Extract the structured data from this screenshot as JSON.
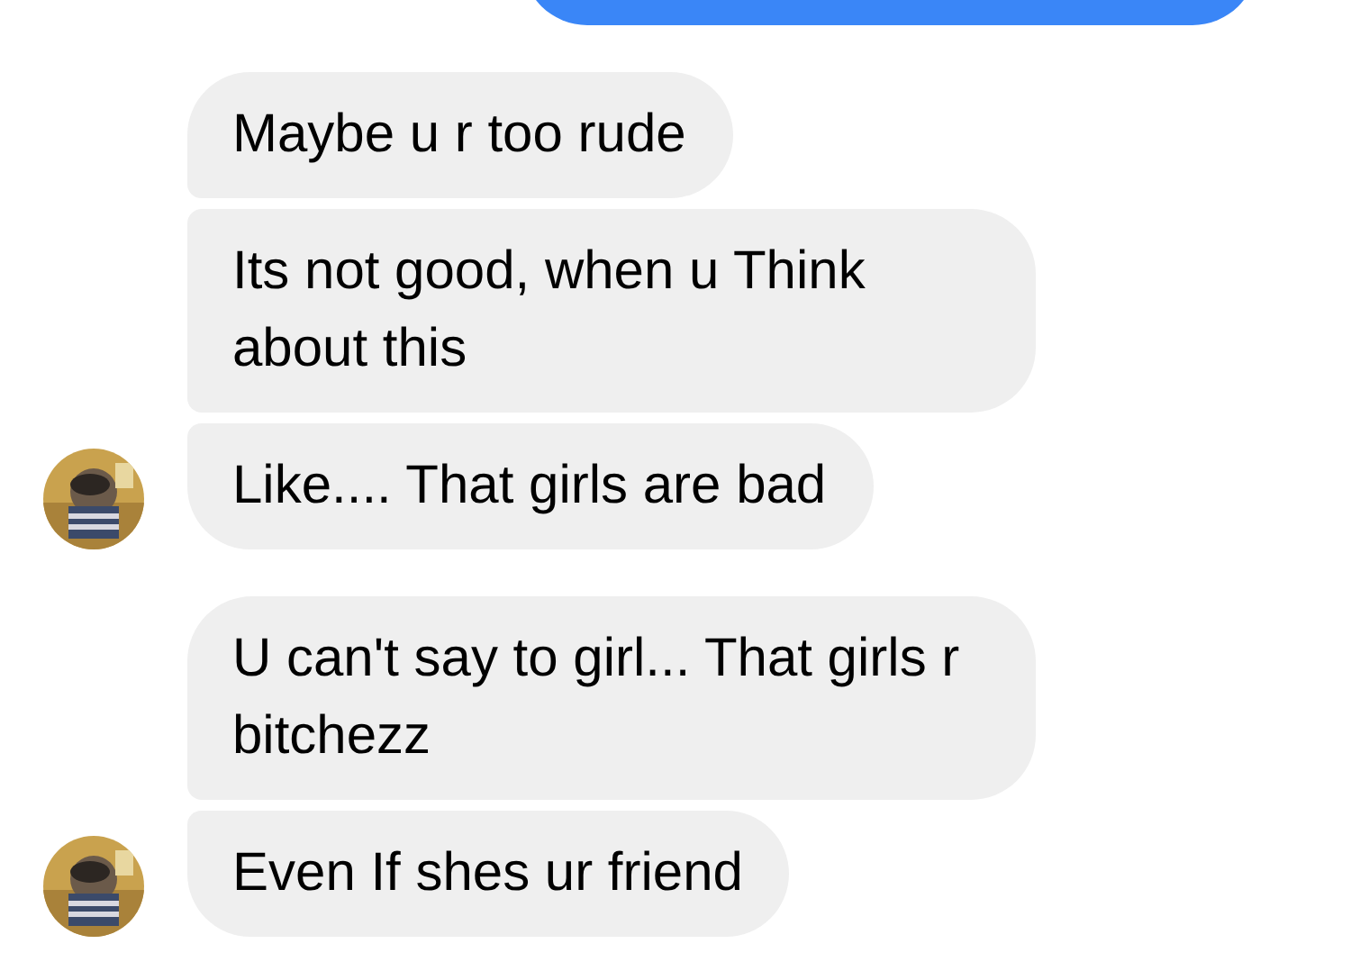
{
  "groups": [
    {
      "kind": "outgoing"
    },
    {
      "kind": "incoming",
      "messages": [
        {
          "text": "Maybe u r too rude"
        },
        {
          "text": "Its not good, when u Think about this"
        },
        {
          "text": "Like.... That girls are bad"
        }
      ]
    },
    {
      "kind": "incoming",
      "messages": [
        {
          "text": "U can't say to girl... That girls r bitchezz"
        },
        {
          "text": "Even If shes ur friend"
        }
      ]
    }
  ]
}
